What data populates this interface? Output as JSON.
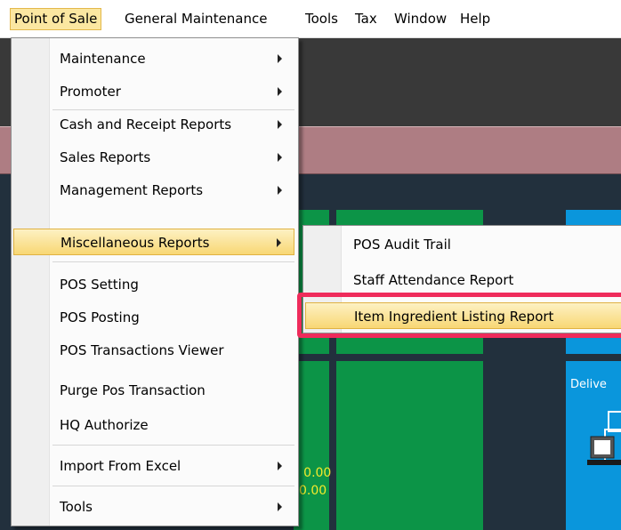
{
  "menubar": {
    "items": [
      "Point of Sale",
      "General Maintenance",
      "Tools",
      "Tax",
      "Window",
      "Help"
    ],
    "active_index": 0
  },
  "dropdown": {
    "items": [
      {
        "label": "Maintenance",
        "has_submenu": true
      },
      {
        "label": "Promoter",
        "has_submenu": true
      },
      {
        "label": "Cash and Receipt Reports",
        "has_submenu": true
      },
      {
        "label": "Sales Reports",
        "has_submenu": true
      },
      {
        "label": "Management Reports",
        "has_submenu": true
      },
      {
        "label": "Miscellaneous Reports",
        "has_submenu": true,
        "highlighted": true
      },
      {
        "label": "POS Setting",
        "has_submenu": false
      },
      {
        "label": "POS Posting",
        "has_submenu": false
      },
      {
        "label": "POS Transactions Viewer",
        "has_submenu": false
      },
      {
        "label": "Purge Pos Transaction",
        "has_submenu": false
      },
      {
        "label": "HQ Authorize",
        "has_submenu": false
      },
      {
        "label": "Import From Excel",
        "has_submenu": true
      },
      {
        "label": "Tools",
        "has_submenu": true
      }
    ]
  },
  "submenu": {
    "items": [
      {
        "label": "POS Audit Trail"
      },
      {
        "label": "Staff Attendance Report"
      },
      {
        "label": "Item Ingredient Listing Report",
        "highlighted": true
      }
    ]
  },
  "background": {
    "delivery_tile_label": "Delive",
    "amount_line_1": ": 0.00",
    "amount_line_2": "0.00"
  },
  "colors": {
    "callout_border": "#ef2b5b",
    "highlight_bg": "#f8d774",
    "tile_green": "#0c9447",
    "tile_blue": "#0a96dc"
  }
}
